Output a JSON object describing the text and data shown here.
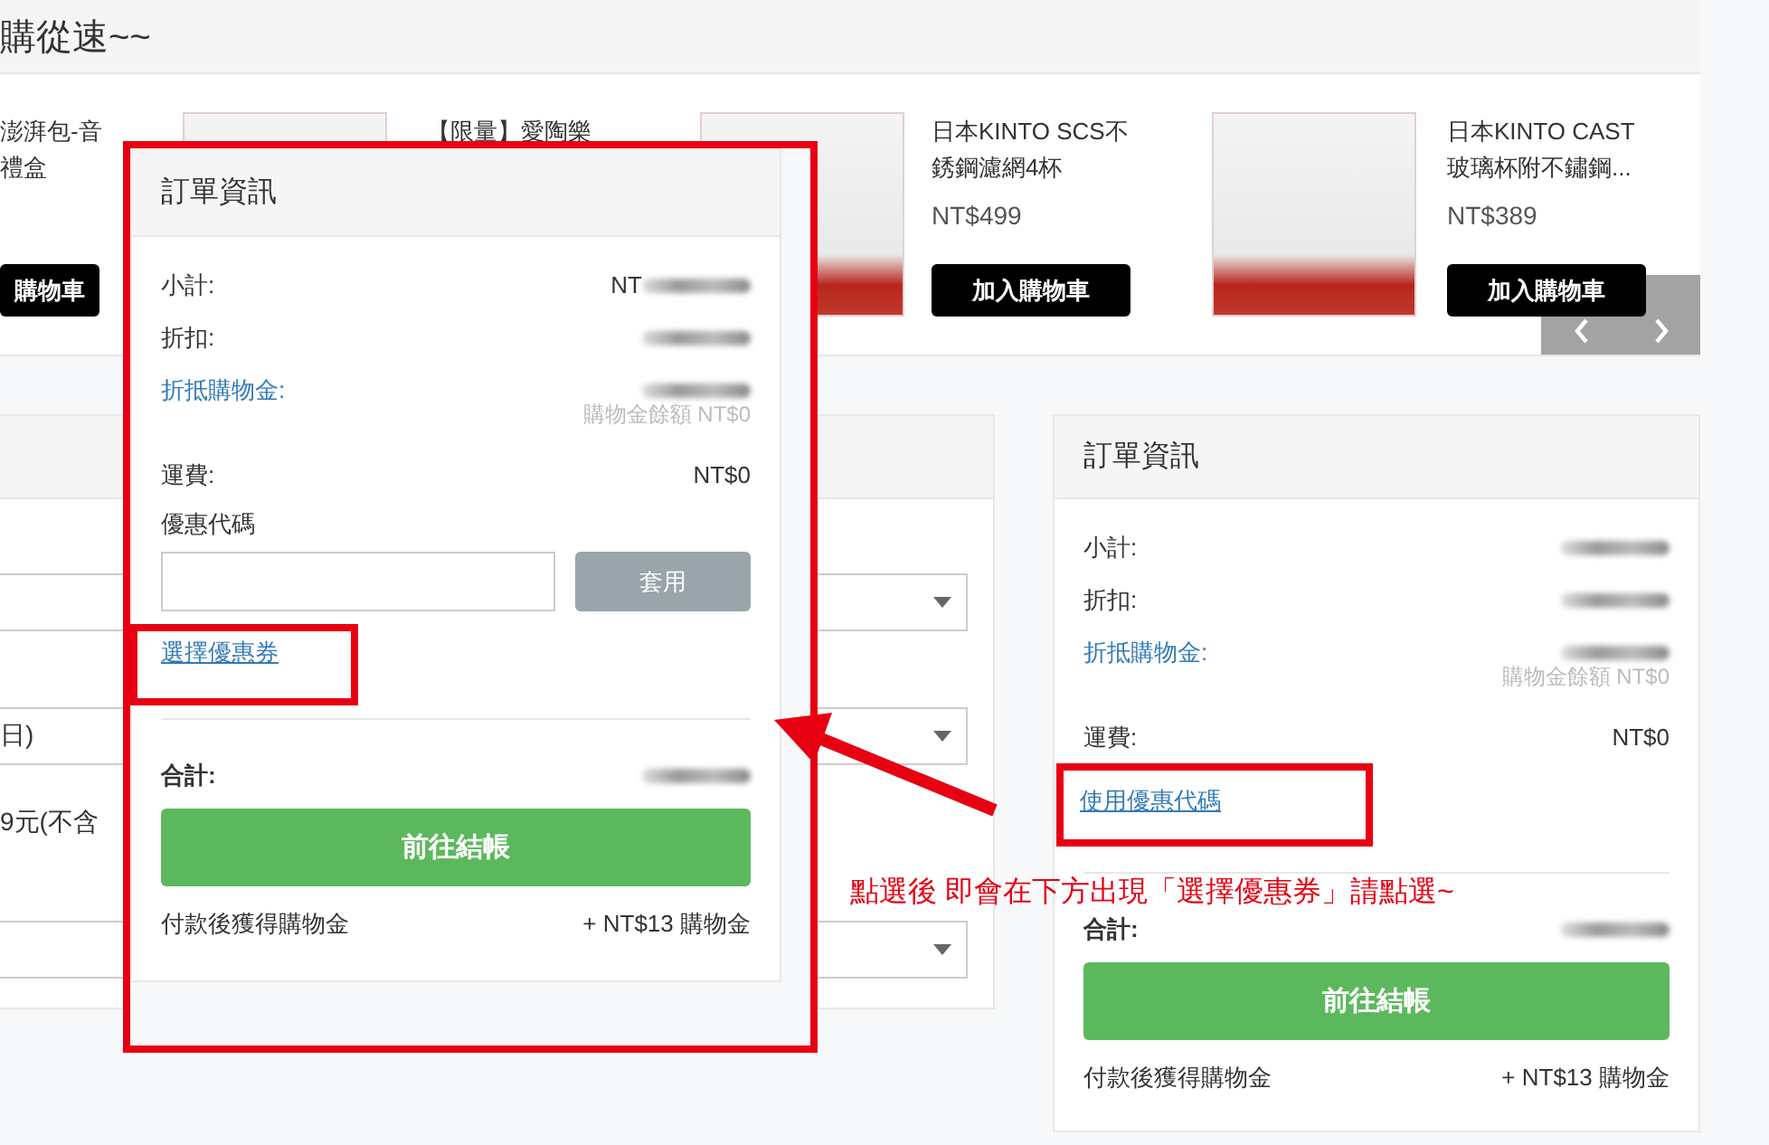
{
  "section_header": {
    "title": "購從速~~"
  },
  "products": [
    {
      "kind": "text",
      "name_lines": [
        "澎湃包-音",
        "禮盒"
      ],
      "button": "購物車"
    },
    {
      "kind": "photo",
      "name_lines": [
        "【限量】愛陶樂"
      ]
    },
    {
      "kind": "photo",
      "name_lines": [
        "日本KINTO SCS不",
        "銹鋼濾網4杯"
      ],
      "price": "NT$499",
      "button": "加入購物車"
    },
    {
      "kind": "photo",
      "name_lines": [
        "日本KINTO CAST",
        "玻璃杯附不鏽鋼..."
      ],
      "price": "NT$389",
      "button": "加入購物車"
    }
  ],
  "shipping_form": {
    "fields": [
      {
        "kind": "select"
      },
      {
        "kind": "select",
        "value": "日)"
      },
      {
        "kind": "text",
        "text": "9元(不含"
      },
      {
        "kind": "select"
      }
    ]
  },
  "popup_order_summary": {
    "title": "訂單資訊",
    "highlighted": true,
    "rows": [
      {
        "kind": "amount",
        "label": "小計:",
        "value": "NT",
        "blurred": true
      },
      {
        "kind": "amount",
        "label": "折扣:",
        "blurred": true
      },
      {
        "kind": "credit",
        "label": "折抵購物金:",
        "blurred": true,
        "note": "購物金餘額 NT$0"
      },
      {
        "kind": "amount",
        "label": "運費:",
        "value": "NT$0"
      }
    ],
    "coupon": {
      "label": "優惠代碼",
      "button": "套用"
    },
    "link": {
      "text": "選擇優惠券",
      "highlighted": true
    },
    "total": {
      "label": "合計:",
      "blurred": true
    },
    "checkout_button": "前往結帳",
    "reward": {
      "label": "付款後獲得購物金",
      "value": "+ NT$13 購物金"
    }
  },
  "order_summary": {
    "title": "訂單資訊",
    "rows": [
      {
        "kind": "amount",
        "label": "小計:",
        "blurred": true
      },
      {
        "kind": "amount",
        "label": "折扣:",
        "blurred": true
      },
      {
        "kind": "credit",
        "label": "折抵購物金:",
        "blurred": true,
        "note": "購物金餘額 NT$0"
      },
      {
        "kind": "amount",
        "label": "運費:",
        "value": "NT$0"
      }
    ],
    "link": {
      "text": "使用優惠代碼",
      "highlighted": true
    },
    "total": {
      "label": "合計:",
      "blurred": true
    },
    "checkout_button": "前往結帳",
    "reward": {
      "label": "付款後獲得購物金",
      "value": "+ NT$13 購物金"
    }
  },
  "annotation": {
    "note": "點選後 即會在下方出現「選擇優惠券」請點選~"
  }
}
